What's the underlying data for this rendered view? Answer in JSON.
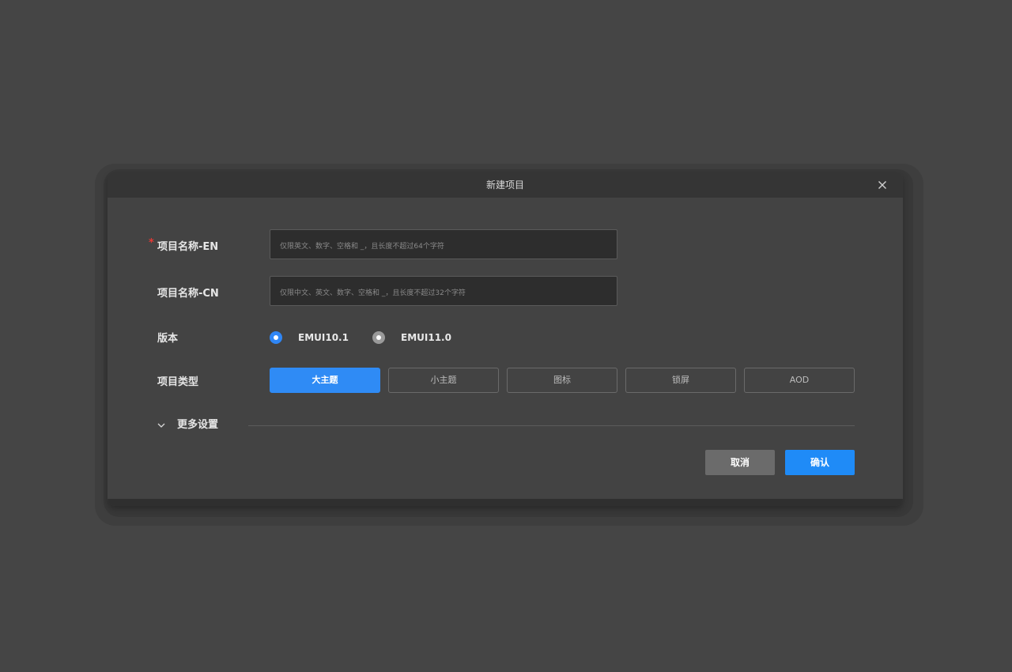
{
  "dialog": {
    "title": "新建项目",
    "close_icon": "close-icon"
  },
  "form": {
    "name_en": {
      "required_mark": "*",
      "label": "项目名称-EN",
      "value": "",
      "placeholder": "仅限英文、数字、空格和 _，且长度不超过64个字符"
    },
    "name_cn": {
      "label": "项目名称-CN",
      "value": "",
      "placeholder": "仅限中文、英文、数字、空格和 _，且长度不超过32个字符"
    },
    "version": {
      "label": "版本",
      "options": [
        {
          "label": "EMUI10.1",
          "checked": true
        },
        {
          "label": "EMUI11.0",
          "checked": false
        }
      ]
    },
    "project_type": {
      "label": "项目类型",
      "options": [
        {
          "label": "大主题",
          "selected": true
        },
        {
          "label": "小主题",
          "selected": false
        },
        {
          "label": "图标",
          "selected": false
        },
        {
          "label": "锁屏",
          "selected": false
        },
        {
          "label": "AOD",
          "selected": false
        }
      ]
    },
    "more_settings": {
      "label": "更多设置",
      "icon": "chevron-down-icon",
      "expanded": false
    }
  },
  "actions": {
    "cancel_label": "取消",
    "confirm_label": "确认"
  },
  "colors": {
    "accent": "#2f8bf5",
    "required": "#e53935",
    "background": "#454545",
    "dialog": "#434343",
    "header": "#353535"
  }
}
